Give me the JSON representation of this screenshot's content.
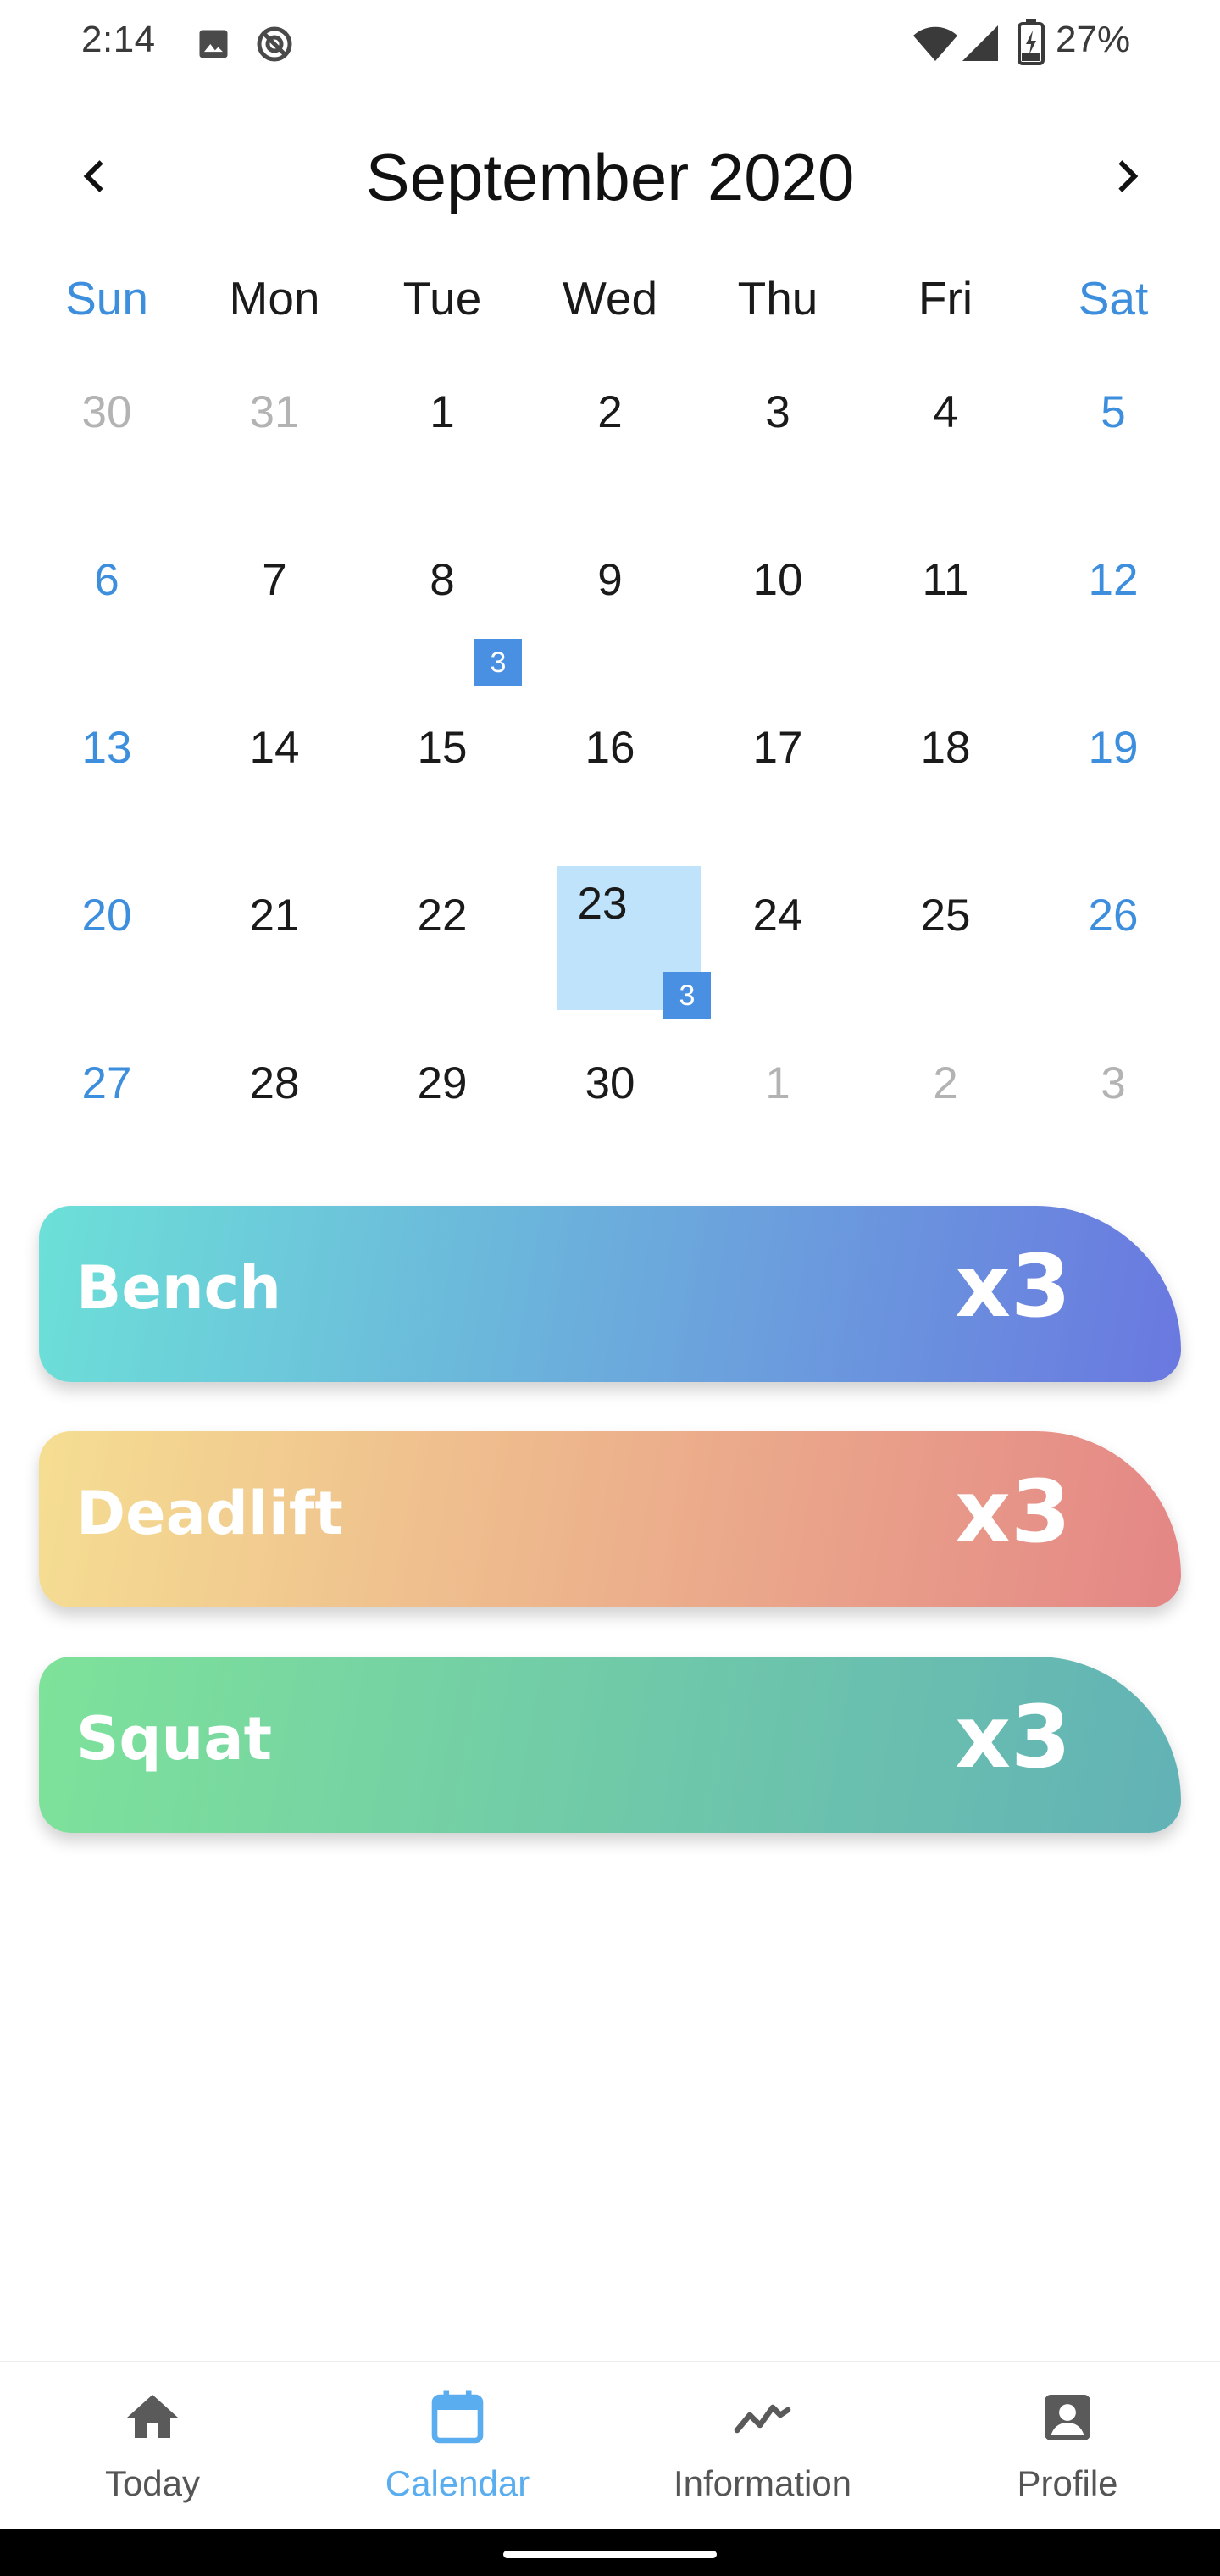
{
  "status_bar": {
    "time": "2:14",
    "battery": "27%",
    "icons": [
      "image-icon",
      "sync-off-icon",
      "wifi-icon",
      "signal-icon",
      "battery-charging-icon"
    ]
  },
  "calendar": {
    "month_title": "September 2020",
    "prev_icon": "chevron-left-icon",
    "next_icon": "chevron-right-icon",
    "weekdays": [
      "Sun",
      "Mon",
      "Tue",
      "Wed",
      "Thu",
      "Fri",
      "Sat"
    ],
    "weeks": [
      [
        "30",
        "31",
        "1",
        "2",
        "3",
        "4",
        "5"
      ],
      [
        "6",
        "7",
        "8",
        "9",
        "10",
        "11",
        "12"
      ],
      [
        "13",
        "14",
        "15",
        "16",
        "17",
        "18",
        "19"
      ],
      [
        "20",
        "21",
        "22",
        "23",
        "24",
        "25",
        "26"
      ],
      [
        "27",
        "28",
        "29",
        "30",
        "1",
        "2",
        "3"
      ]
    ],
    "selected_day": "23",
    "badges": {
      "sep_8": "3",
      "sep_23": "3"
    },
    "weekend_color": "#3d8fde",
    "outside_color": "#b3b3b3",
    "selected_bg_color": "#bfe3fb",
    "badge_color": "#4a90e2"
  },
  "exercises": [
    {
      "name": "Bench",
      "count": "x3",
      "gradient": [
        "#6ce0d8",
        "#6a78e0"
      ]
    },
    {
      "name": "Deadlift",
      "count": "x3",
      "gradient": [
        "#f5de92",
        "#e48686"
      ]
    },
    {
      "name": "Squat",
      "count": "x3",
      "gradient": [
        "#7ee29a",
        "#62b2b6"
      ]
    }
  ],
  "bottom_nav": {
    "items": [
      {
        "label": "Today",
        "icon": "home-icon"
      },
      {
        "label": "Calendar",
        "icon": "calendar-icon"
      },
      {
        "label": "Information",
        "icon": "trending-icon"
      },
      {
        "label": "Profile",
        "icon": "profile-icon"
      }
    ],
    "active": "Calendar",
    "active_color": "#5aaef0"
  }
}
